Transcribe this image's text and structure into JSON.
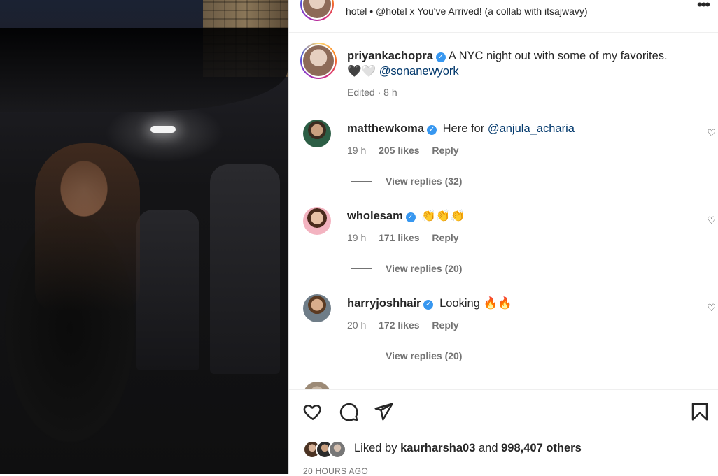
{
  "post": {
    "audio_prefix": "hotel",
    "audio_sep": "•",
    "audio_label": "@hotel x You've Arrived! (a collab with itsajwavy)"
  },
  "caption": {
    "username": "priyankachopra",
    "text": "A NYC night out with some of my favorites.",
    "emoji": "🖤🤍",
    "mention": "@sonanewyork",
    "edited": "Edited",
    "dot": "·",
    "time": "8 h"
  },
  "comments": [
    {
      "username": "matthewkoma",
      "text": "Here for",
      "mention": "@anjula_acharia",
      "time": "19 h",
      "likes": "205 likes",
      "reply": "Reply",
      "replies": "View replies (32)"
    },
    {
      "username": "wholesam",
      "text": "👏👏👏",
      "mention": "",
      "time": "19 h",
      "likes": "171 likes",
      "reply": "Reply",
      "replies": "View replies (20)"
    },
    {
      "username": "harryjoshhair",
      "text": "Looking 🔥🔥",
      "mention": "",
      "time": "20 h",
      "likes": "172 likes",
      "reply": "Reply",
      "replies": "View replies (20)"
    }
  ],
  "likes": {
    "liked_by": "Liked by",
    "user": "kaurharsha03",
    "and": "and",
    "count": "998,407 others"
  },
  "time_ago": "20 HOURS AGO",
  "icons": {
    "more": "more-options-icon",
    "heart": "heart-icon",
    "comment": "comment-icon",
    "share": "share-icon",
    "save": "bookmark-icon",
    "verified": "verified-badge-icon"
  },
  "colors": {
    "accent_blue": "#3797f0",
    "link": "#00376b",
    "muted": "#737373",
    "text": "#262626"
  }
}
